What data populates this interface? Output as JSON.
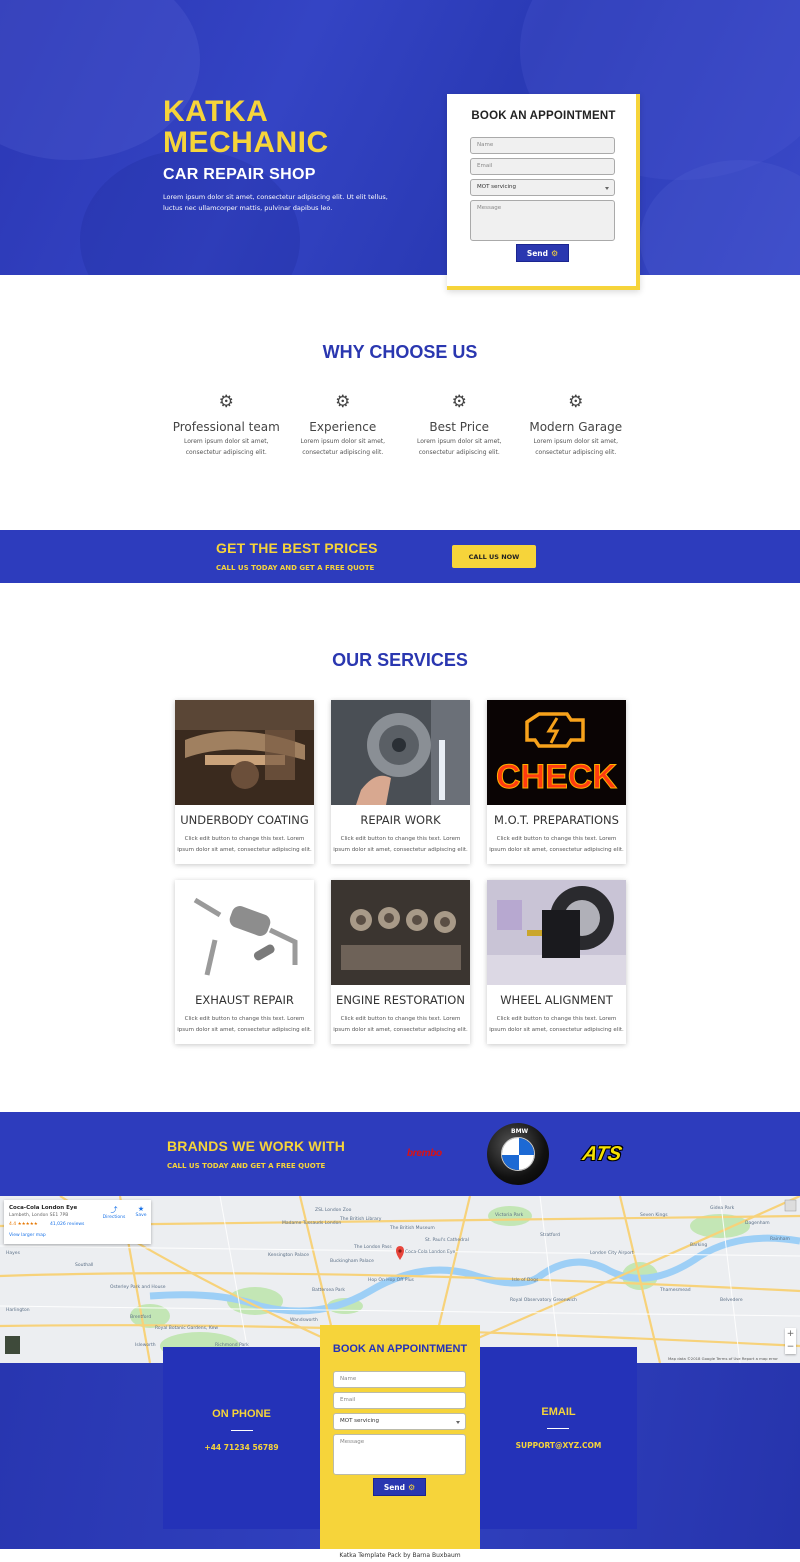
{
  "hero": {
    "title": "KATKA MECHANIC",
    "subtitle": "CAR REPAIR SHOP",
    "text": "Lorem ipsum dolor sit amet, consectetur adipiscing elit. Ut elit tellus, luctus nec ullamcorper mattis, pulvinar dapibus leo."
  },
  "appointment": {
    "title": "BOOK AN APPOINTMENT",
    "name_placeholder": "Name",
    "email_placeholder": "Email",
    "service_selected": "MOT servicing",
    "message_placeholder": "Message",
    "send_label": "Send"
  },
  "why": {
    "title": "WHY CHOOSE US",
    "features": [
      {
        "name": "Professional team",
        "desc": "Lorem ipsum dolor sit amet, consectetur adipiscing elit.",
        "icon": "gears-icon"
      },
      {
        "name": "Experience",
        "desc": "Lorem ipsum dolor sit amet, consectetur adipiscing elit.",
        "icon": "gears-icon"
      },
      {
        "name": "Best Price",
        "desc": "Lorem ipsum dolor sit amet, consectetur adipiscing elit.",
        "icon": "gears-icon"
      },
      {
        "name": "Modern Garage",
        "desc": "Lorem ipsum dolor sit amet, consectetur adipiscing elit.",
        "icon": "gears-icon"
      }
    ]
  },
  "prices": {
    "title": "GET THE BEST PRICES",
    "subtitle": "CALL US TODAY AND GET A FREE QUOTE",
    "button": "CALL US NOW"
  },
  "services": {
    "title": "OUR SERVICES",
    "items": [
      {
        "name": "UNDERBODY COATING",
        "desc": "Click edit button to change this text. Lorem ipsum dolor sit amet, consectetur adipiscing elit."
      },
      {
        "name": "REPAIR WORK",
        "desc": "Click edit button to change this text. Lorem ipsum dolor sit amet, consectetur adipiscing elit."
      },
      {
        "name": "M.O.T. PREPARATIONS",
        "desc": "Click edit button to change this text. Lorem ipsum dolor sit amet, consectetur adipiscing elit.",
        "image_text": "CHECK"
      },
      {
        "name": "EXHAUST REPAIR",
        "desc": "Click edit button to change this text. Lorem ipsum dolor sit amet, consectetur adipiscing elit."
      },
      {
        "name": "ENGINE RESTORATION",
        "desc": "Click edit button to change this text. Lorem ipsum dolor sit amet, consectetur adipiscing elit."
      },
      {
        "name": "WHEEL ALIGNMENT",
        "desc": "Click edit button to change this text. Lorem ipsum dolor sit amet, consectetur adipiscing elit."
      }
    ]
  },
  "brands": {
    "title": "BRANDS WE WORK WITH",
    "subtitle": "CALL US TODAY AND GET A FREE QUOTE",
    "logos": [
      "brembo",
      "BMW",
      "ATS"
    ]
  },
  "map": {
    "place": "Coca-Cola London Eye",
    "address": "Lambeth, London SE1 7PB",
    "rating": "4.4 ★★★★★",
    "reviews": "41,026 reviews",
    "larger_map": "View larger map",
    "directions": "Directions",
    "save": "Save",
    "labels": [
      "ZSL London Zoo",
      "The British Library",
      "The British Museum",
      "Victoria Park",
      "Madame Tussauds London",
      "St. Paul's Cathedral",
      "The London Pass",
      "Coca-Cola London Eye",
      "Buckingham Palace",
      "Kensington Palace",
      "Hop On Hop Off Plus",
      "Battersea Park",
      "Isle of Dogs",
      "Royal Observatory Greenwich",
      "Richmond Park",
      "Wandsworth",
      "Hayes",
      "Southall",
      "Brentford",
      "Harlington",
      "Royal Botanic Gardens, Kew",
      "Isleworth",
      "London City Airport",
      "Barking",
      "Rainham",
      "Belvedere",
      "Gidea Park",
      "Seven Kings",
      "Osterley Park and House",
      "Stratford",
      "Dagenham",
      "Thamesmead"
    ],
    "credit": "Map data ©2018 Google   Terms of Use   Report a map error",
    "colors": {
      "water": "#8fc8f5",
      "road": "#f7c94a",
      "park": "#bde3ae"
    }
  },
  "contact": {
    "phone_label": "ON PHONE",
    "phone": "+44 71234 56789",
    "email_label": "EMAIL",
    "email": "SUPPORT@XYZ.COM"
  },
  "footer": "Katka Template Pack by Barna Buxbaum",
  "colors": {
    "brand_blue": "#2a37b0",
    "accent_yellow": "#f6d43a"
  }
}
